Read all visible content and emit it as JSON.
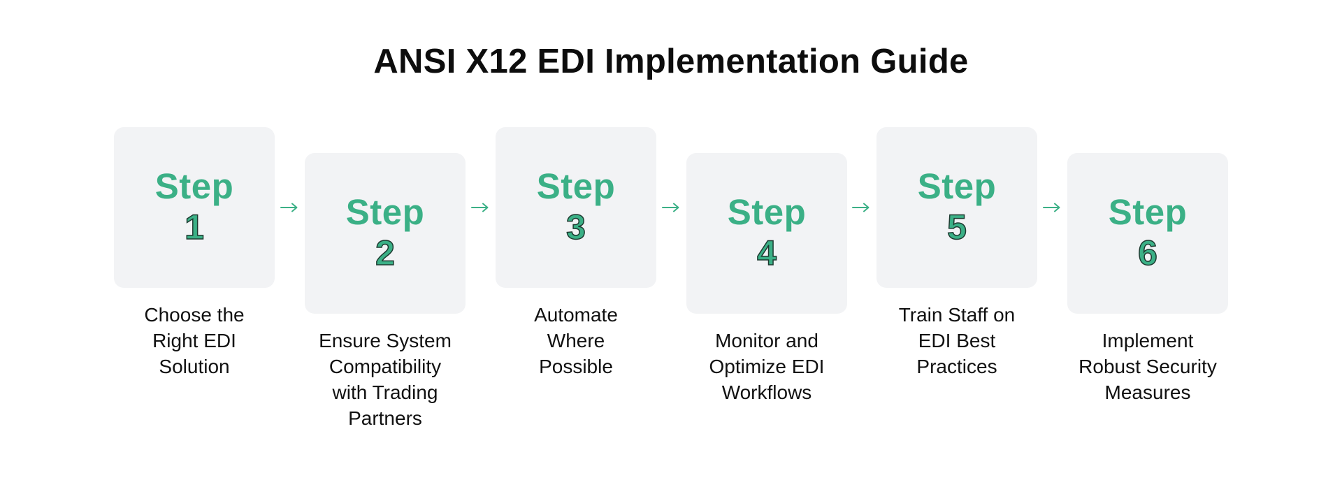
{
  "title": "ANSI X12 EDI Implementation Guide",
  "accent_color": "#3bb086",
  "steps": [
    {
      "word": "Step",
      "number": "1",
      "label_lines": [
        "Choose the",
        "Right EDI",
        "Solution"
      ]
    },
    {
      "word": "Step",
      "number": "2",
      "label_lines": [
        "Ensure System",
        "Compatibility",
        "with Trading",
        "Partners"
      ]
    },
    {
      "word": "Step",
      "number": "3",
      "label_lines": [
        "Automate",
        "Where",
        "Possible"
      ]
    },
    {
      "word": "Step",
      "number": "4",
      "label_lines": [
        "Monitor and",
        "Optimize EDI",
        "Workflows"
      ]
    },
    {
      "word": "Step",
      "number": "5",
      "label_lines": [
        "Train Staff on",
        "EDI Best",
        "Practices"
      ]
    },
    {
      "word": "Step",
      "number": "6",
      "label_lines": [
        "Implement",
        "Robust Security",
        "Measures"
      ]
    }
  ],
  "connectors": [
    {
      "from": "1",
      "to": "2",
      "icon": "arrow-right-icon"
    },
    {
      "from": "2",
      "to": "3",
      "icon": "arrow-right-icon"
    },
    {
      "from": "3",
      "to": "4",
      "icon": "arrow-right-icon"
    },
    {
      "from": "4",
      "to": "5",
      "icon": "arrow-right-icon"
    },
    {
      "from": "5",
      "to": "6",
      "icon": "arrow-right-icon"
    }
  ]
}
